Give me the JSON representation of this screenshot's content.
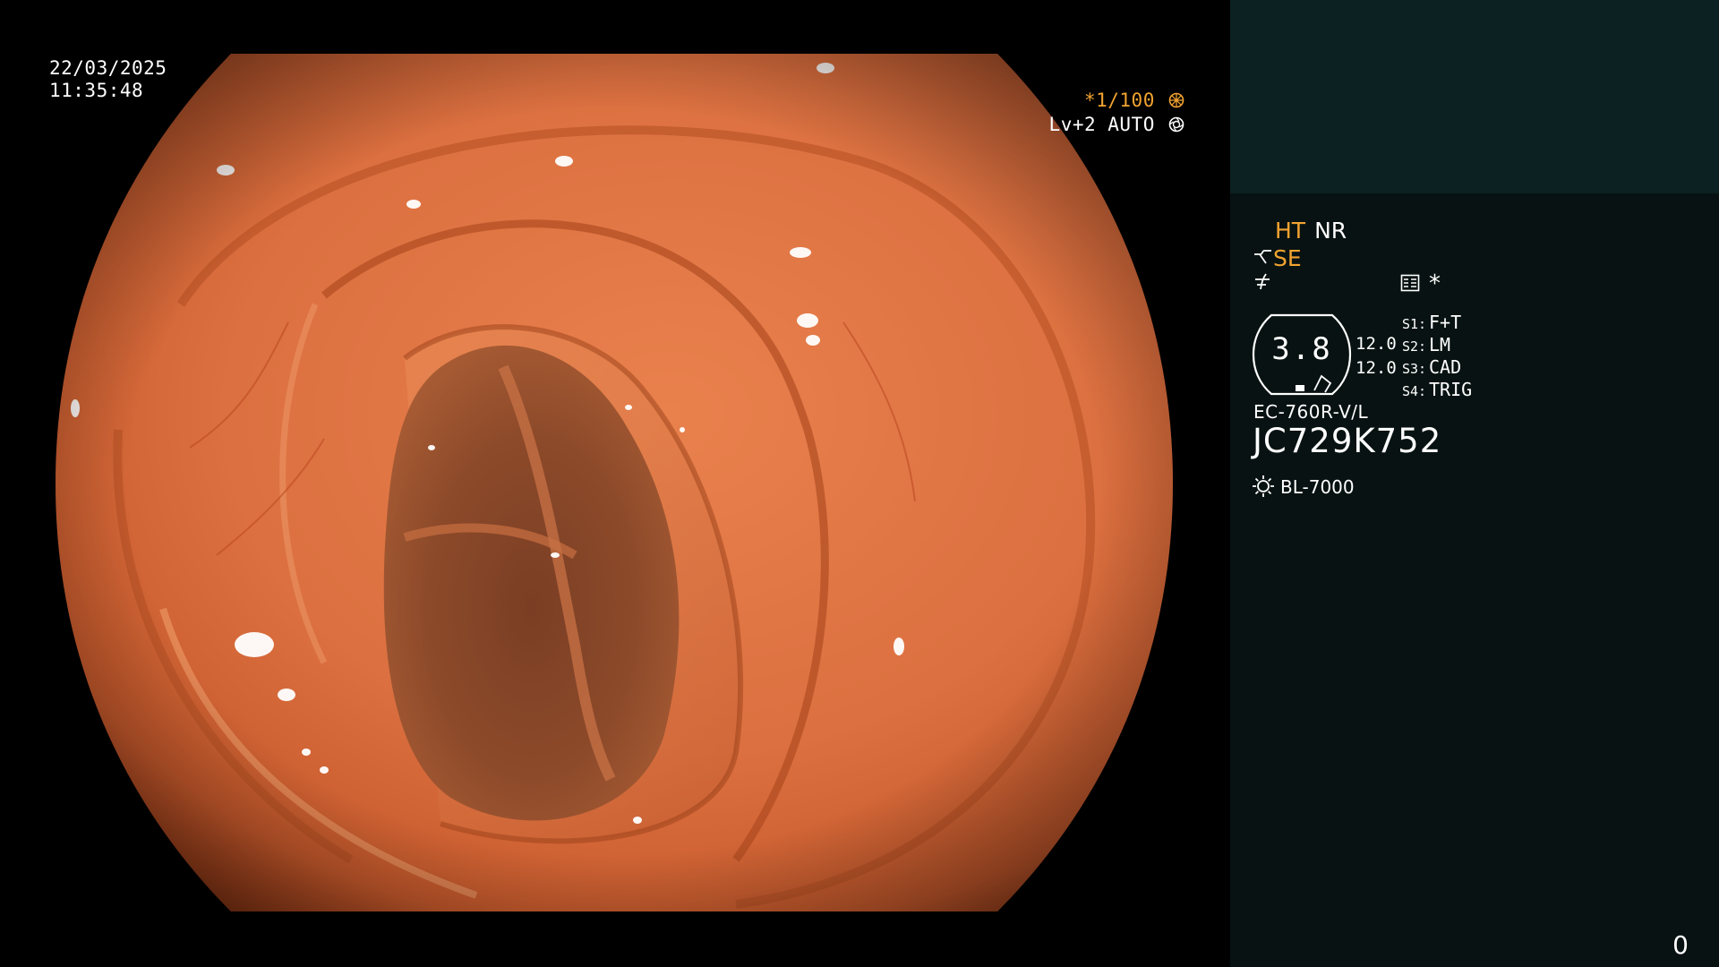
{
  "video": {
    "date": "22/03/2025",
    "time": "11:35:48",
    "shutter": "*1/100",
    "shutter_icon": "shutter-dial-icon",
    "level": "Lv+2 AUTO",
    "level_icon": "iris-icon",
    "frame_counter": "0"
  },
  "panel": {
    "ht": "HT",
    "nr": "NR",
    "se": "SE",
    "se_icon": "enhance-curve-icon",
    "color_icon": "color-tone-icon",
    "memo_icon": "memo-icon",
    "star": "*",
    "zoom": {
      "value": "3.8",
      "line1": "12.0",
      "line2": "12.0"
    },
    "switches": [
      {
        "key": "S1:",
        "value": "F+T"
      },
      {
        "key": "S2:",
        "value": "LM"
      },
      {
        "key": "S3:",
        "value": "CAD"
      },
      {
        "key": "S4:",
        "value": "TRIG"
      }
    ],
    "scope_model": "EC-760R-V/L",
    "scope_serial": "JC729K752",
    "light_source": "BL-7000",
    "light_icon": "light-source-icon"
  },
  "colors": {
    "osd_orange": "#f2a330",
    "panel_top": "#0c2121",
    "panel_bottom": "#081212"
  }
}
